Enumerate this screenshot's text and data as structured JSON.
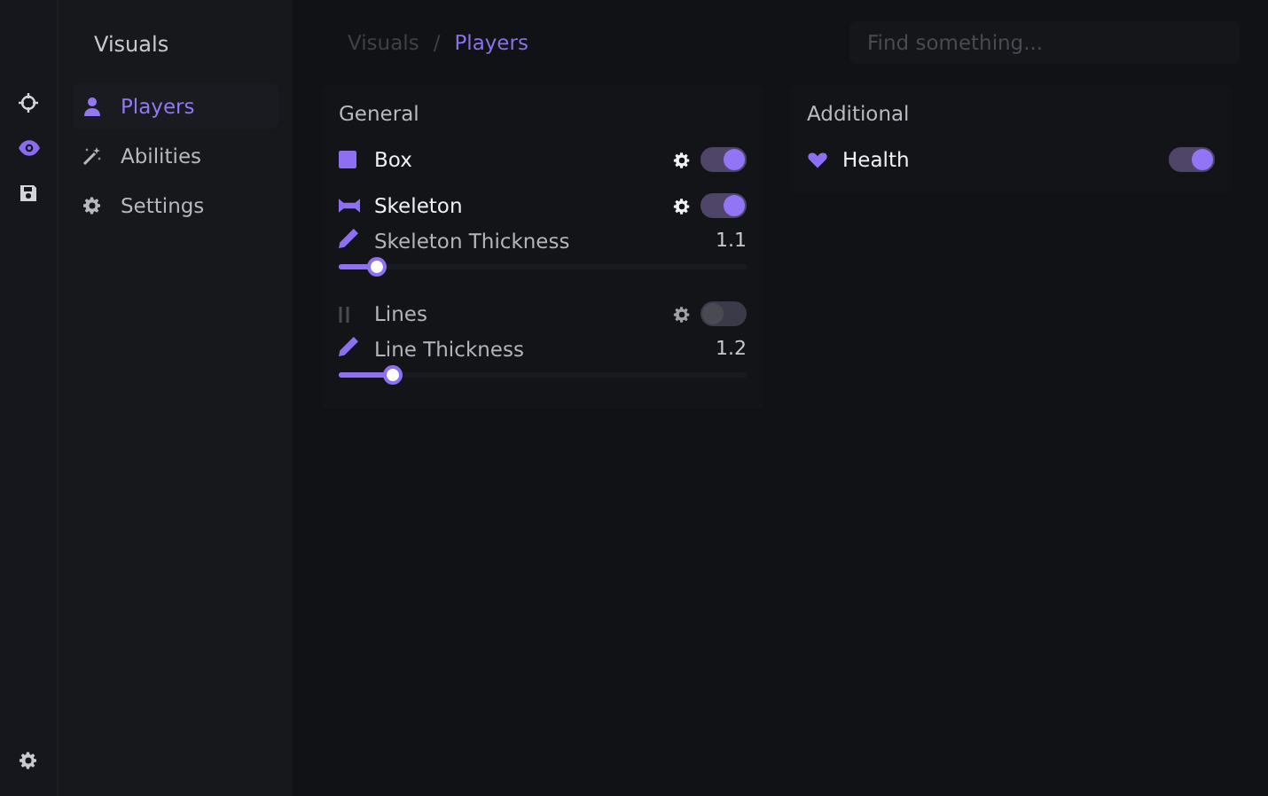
{
  "rail": [
    {
      "selected": false
    },
    {
      "selected": true
    },
    {
      "selected": false
    }
  ],
  "sidebar": {
    "title": "Visuals",
    "items": [
      {
        "label": "Players",
        "selected": true
      },
      {
        "label": "Abilities",
        "selected": false
      },
      {
        "label": "Settings",
        "selected": false
      }
    ]
  },
  "breadcrumb": {
    "parent": "Visuals",
    "separator": "/",
    "current": "Players"
  },
  "search": {
    "placeholder": "Find something..."
  },
  "panels": [
    {
      "title": "General",
      "rows": [
        {
          "kind": "toggle",
          "label": "Box",
          "gear": true,
          "on": true
        },
        {
          "kind": "toggle",
          "label": "Skeleton",
          "gear": true,
          "on": true
        },
        {
          "kind": "slider",
          "label": "Skeleton Thickness",
          "value": "1.1",
          "level": 0.09
        },
        {
          "kind": "toggle",
          "label": "Lines",
          "gear": true,
          "on": false
        },
        {
          "kind": "slider",
          "label": "Line Thickness",
          "value": "1.2",
          "level": 0.13
        }
      ]
    },
    {
      "title": "Additional",
      "rows": [
        {
          "kind": "toggle",
          "label": "Health",
          "gear": false,
          "on": true
        }
      ]
    }
  ]
}
